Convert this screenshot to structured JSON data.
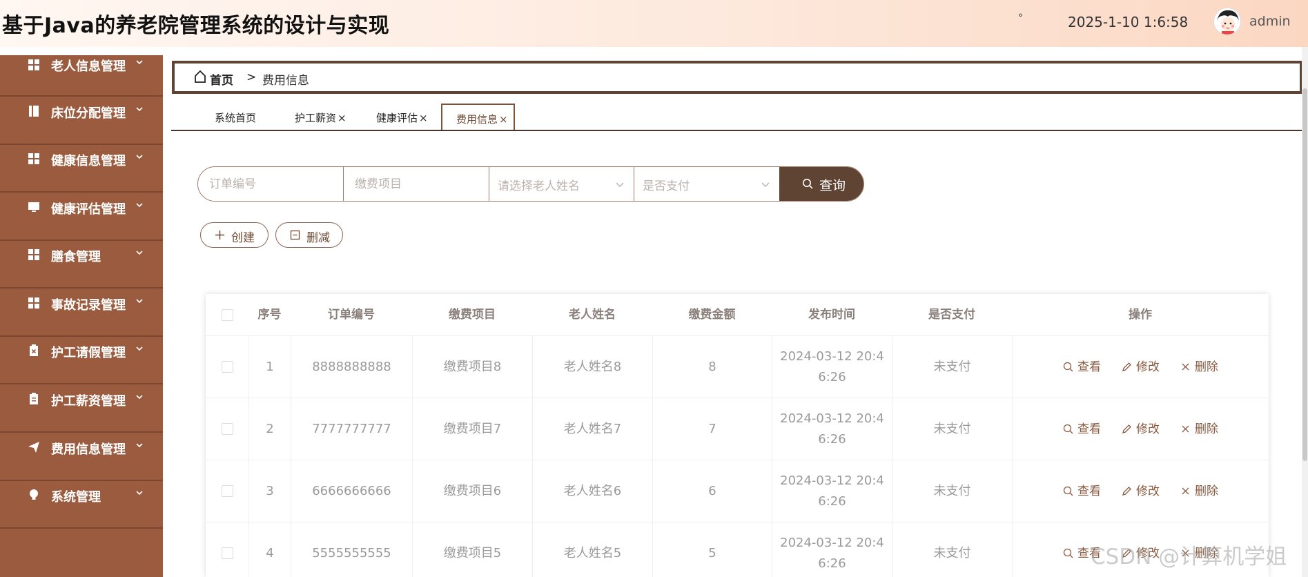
{
  "header": {
    "title": "基于Java的养老院管理系统的设计与实现",
    "dot": "°",
    "datetime": "2025-1-10 1:6:58",
    "user": "admin"
  },
  "sidebar": {
    "items": [
      {
        "label": "老人信息管理",
        "icon": "grid-icon"
      },
      {
        "label": "床位分配管理",
        "icon": "book-icon"
      },
      {
        "label": "健康信息管理",
        "icon": "grid-icon"
      },
      {
        "label": "健康评估管理",
        "icon": "monitor-icon"
      },
      {
        "label": "膳食管理",
        "icon": "grid-icon"
      },
      {
        "label": "事故记录管理",
        "icon": "grid-icon"
      },
      {
        "label": "护工请假管理",
        "icon": "clipboard-x-icon"
      },
      {
        "label": "护工薪资管理",
        "icon": "clipboard-icon"
      },
      {
        "label": "费用信息管理",
        "icon": "send-icon"
      },
      {
        "label": "系统管理",
        "icon": "bulb-icon"
      }
    ]
  },
  "breadcrumb": {
    "home": "首页",
    "separator": ">",
    "current": "费用信息"
  },
  "tabs": [
    {
      "label": "系统首页",
      "closable": false
    },
    {
      "label": "护工薪资",
      "closable": true
    },
    {
      "label": "健康评估",
      "closable": true
    },
    {
      "label": "费用信息",
      "closable": true,
      "active": true
    }
  ],
  "tab_close": "×",
  "search": {
    "order_placeholder": "订单编号",
    "item_placeholder": "缴费项目",
    "elder_placeholder": "请选择老人姓名",
    "paid_placeholder": "是否支付",
    "button": "查询"
  },
  "actions": {
    "create": "创建",
    "delete": "删减"
  },
  "table": {
    "headers": [
      "序号",
      "订单编号",
      "缴费项目",
      "老人姓名",
      "缴费金额",
      "发布时间",
      "是否支付",
      "操作"
    ],
    "op_labels": {
      "view": "查看",
      "edit": "修改",
      "delete": "删除"
    },
    "rows": [
      {
        "index": "1",
        "order": "8888888888",
        "item": "缴费项目8",
        "name": "老人姓名8",
        "amount": "8",
        "time_line1": "2024-03-12 20:4",
        "time_line2": "6:26",
        "paid": "未支付"
      },
      {
        "index": "2",
        "order": "7777777777",
        "item": "缴费项目7",
        "name": "老人姓名7",
        "amount": "7",
        "time_line1": "2024-03-12 20:4",
        "time_line2": "6:26",
        "paid": "未支付"
      },
      {
        "index": "3",
        "order": "6666666666",
        "item": "缴费项目6",
        "name": "老人姓名6",
        "amount": "6",
        "time_line1": "2024-03-12 20:4",
        "time_line2": "6:26",
        "paid": "未支付"
      },
      {
        "index": "4",
        "order": "5555555555",
        "item": "缴费项目5",
        "name": "老人姓名5",
        "amount": "5",
        "time_line1": "2024-03-12 20:4",
        "time_line2": "6:26",
        "paid": "未支付"
      }
    ]
  },
  "watermark": "CSDN @计算机学姐",
  "colors": {
    "sidebar": "#9a5b3e",
    "accent": "#5f4333",
    "link": "#8a5a40"
  }
}
